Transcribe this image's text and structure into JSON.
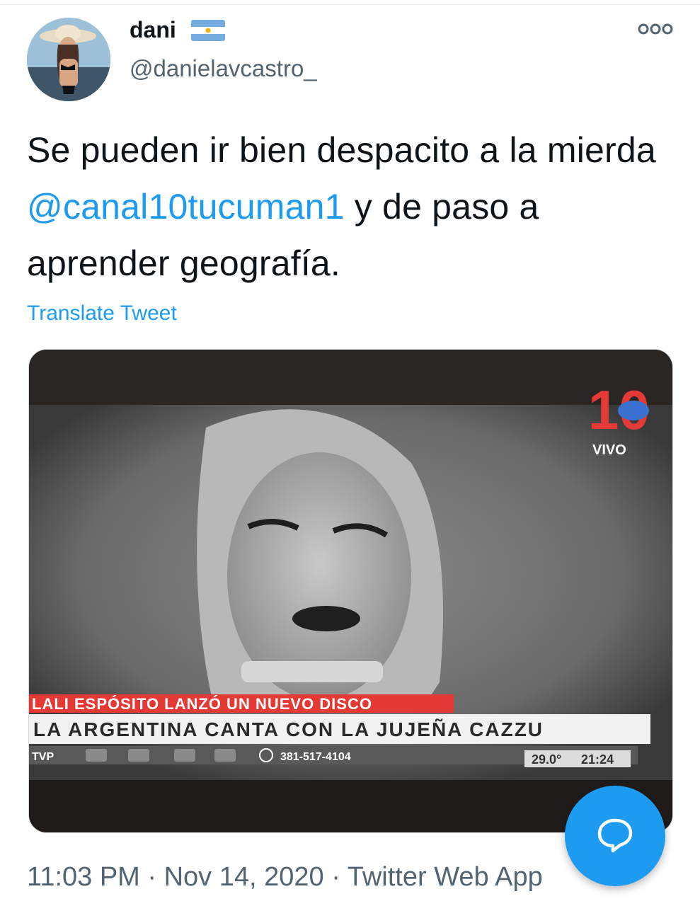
{
  "colors": {
    "accent": "#1d9bf0",
    "text": "#0f1419",
    "secondary": "#536471",
    "ticker_red": "#e53935"
  },
  "tweet": {
    "author": {
      "name": "dani",
      "handle": "@danielavcastro_",
      "flag_icon": "argentina-flag-icon"
    },
    "text_before": "Se pueden ir bien despacito a la mierda ",
    "mention": "@canal10tucuman1",
    "text_after": " y de paso a aprender geografía.",
    "translate_label": "Translate Tweet",
    "timestamp": "11:03 PM · Nov 14, 2020 · Twitter Web App",
    "more_icon": "more-options-icon"
  },
  "media": {
    "channel_logo": "10",
    "live_label": "VIVO",
    "headline_red": "LALI ESPÓSITO LANZÓ UN NUEVO DISCO",
    "headline_white": "LA ARGENTINA CANTA CON LA JUJEÑA CAZZU",
    "ticker_brand": "TVP",
    "ticker_phone": "381-517-4104",
    "temperature": "29.0°",
    "clock": "21:24"
  },
  "compose": {
    "icon": "compose-reply-icon"
  }
}
